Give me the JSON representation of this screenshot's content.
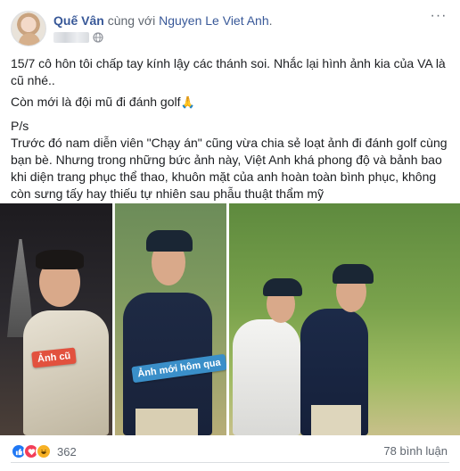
{
  "post": {
    "author": "Quế Vân",
    "with_text": "cùng với",
    "tagged_name": "Nguyen Le Viet Anh",
    "tagged_suffix": ".",
    "more_glyph": "···",
    "paragraphs": [
      "15/7 cô hôn tôi chấp tay kính lậy các thánh soi. Nhắc lại hình ảnh kia của VA là cũ nhé..",
      "Còn mới là đội mũ đi đánh golf",
      "P/s",
      "Trước đó nam diễn viên \"Chạy án\" cũng vừa chia sẻ loạt ảnh đi đánh golf cùng bạn bè. Nhưng trong những bức ảnh này, Việt Anh khá phong độ và bảnh bao khi diện trang phục thể thao, khuôn mặt của anh hoàn toàn bình phục, không còn sưng tấy hay thiếu tự nhiên sau phẫu thuật thẩm mỹ"
    ],
    "emoji": "🙏"
  },
  "photos": {
    "left_tag_old": "Ảnh cũ",
    "left_tag_new": "Ảnh mới hôm qua"
  },
  "footer": {
    "reaction_count": "362",
    "comments": "78 bình luận"
  },
  "icons": {
    "privacy": "globe-icon",
    "reactions": [
      "like-icon",
      "love-icon",
      "haha-icon"
    ]
  },
  "colors": {
    "link": "#385898",
    "meta": "#606770",
    "like": "#2078f4",
    "love": "#f33e58",
    "haha": "#f7b125"
  }
}
